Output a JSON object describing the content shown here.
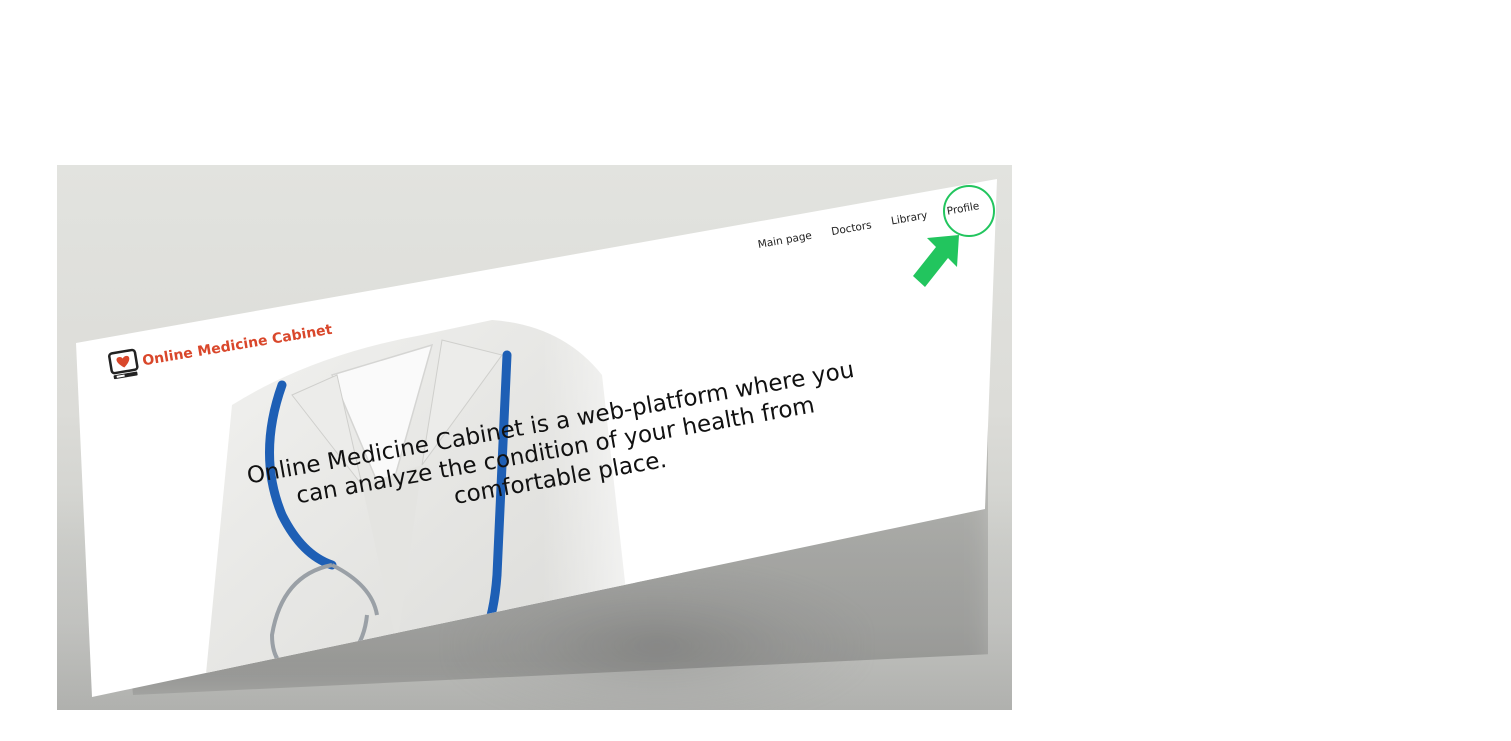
{
  "logo": {
    "text": "Online Medicine Cabinet",
    "icon": "heart-monitor-icon"
  },
  "nav": {
    "items": [
      {
        "label": "Main page"
      },
      {
        "label": "Doctors"
      },
      {
        "label": "Library"
      },
      {
        "label": "Profile"
      }
    ]
  },
  "hero": {
    "headline": "Online Medicine Cabinet is a web-platform where you can analyze the condition of your health from comfortable place."
  },
  "annotation": {
    "highlight_color": "#22c55e",
    "target": "Profile"
  },
  "colors": {
    "brand": "#d9472b",
    "stethoscope": "#1e5fb5",
    "highlight": "#22c55e"
  }
}
